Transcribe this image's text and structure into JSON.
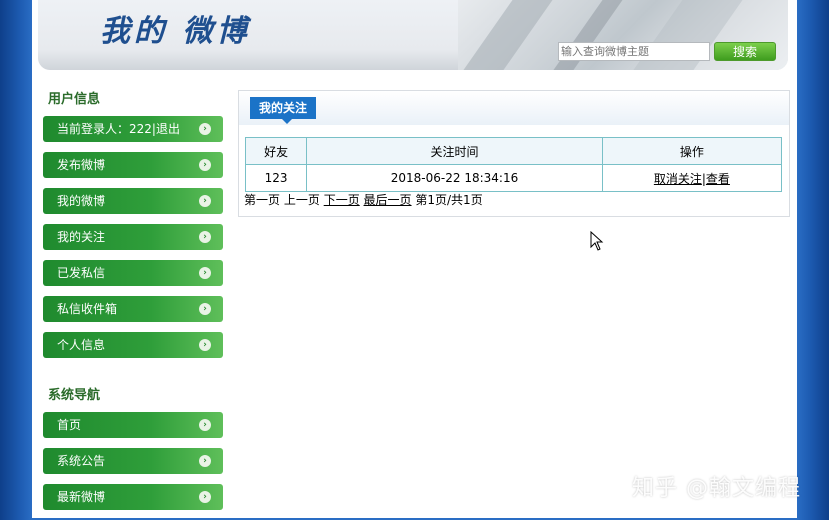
{
  "header": {
    "logo": "我的 微博",
    "search": {
      "placeholder": "输入查询微博主题",
      "value": "",
      "button": "搜索"
    }
  },
  "sidebar": {
    "user_section_title": "用户信息",
    "user_items": [
      {
        "label": "当前登录人：222|退出"
      },
      {
        "label": "发布微博"
      },
      {
        "label": "我的微博"
      },
      {
        "label": "我的关注"
      },
      {
        "label": "已发私信"
      },
      {
        "label": "私信收件箱"
      },
      {
        "label": "个人信息"
      }
    ],
    "system_section_title": "系统导航",
    "system_items": [
      {
        "label": "首页"
      },
      {
        "label": "系统公告"
      },
      {
        "label": "最新微博"
      }
    ]
  },
  "main": {
    "tab": "我的关注",
    "table": {
      "headers": [
        "好友",
        "关注时间",
        "操作"
      ],
      "rows": [
        {
          "friend": "123",
          "time": "2018-06-22 18:34:16",
          "unfollow": "取消关注",
          "separator": "|",
          "view": "查看"
        }
      ]
    },
    "pager": {
      "first": "第一页",
      "prev": "上一页",
      "next": "下一页",
      "last": "最后一页",
      "info": "第1页/共1页"
    }
  },
  "watermark": "知乎 @翰文编程",
  "colors": {
    "background": "#2a6dc4",
    "nav_green": "#2f9e3a",
    "tab_blue": "#1b73c7",
    "section_title": "#2a6b2a"
  }
}
